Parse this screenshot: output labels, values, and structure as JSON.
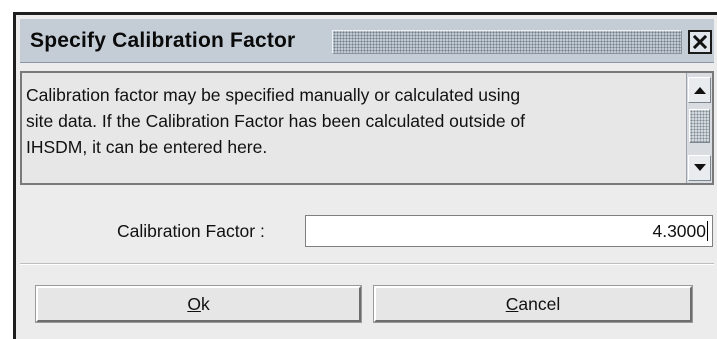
{
  "dialog": {
    "title": "Specify Calibration Factor",
    "close_icon": "close-icon"
  },
  "message": {
    "lines": [
      "Calibration factor may be specified manually or calculated using",
      "site data. If the Calibration Factor has been calculated outside of",
      "IHSDM, it can be entered here."
    ],
    "scroll_up_icon": "arrow-up-icon",
    "scroll_down_icon": "arrow-down-icon"
  },
  "field": {
    "label": "Calibration Factor :",
    "value": "4.3000"
  },
  "buttons": {
    "ok": {
      "mnemonic": "O",
      "rest": "k"
    },
    "cancel": {
      "mnemonic": "C",
      "rest": "ancel"
    }
  },
  "colors": {
    "title_bar": "#c4cdd6",
    "dialog_bg": "#ececec",
    "input_bg": "#ffffff"
  }
}
